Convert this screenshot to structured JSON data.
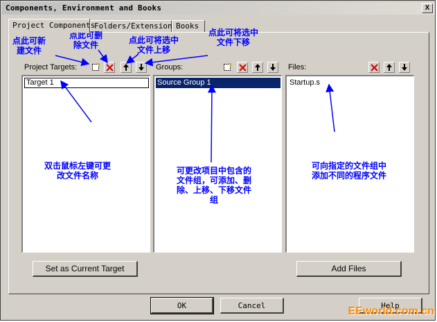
{
  "window": {
    "title": "Components, Environment and Books",
    "close": "X"
  },
  "tabs": [
    {
      "label": "Project Components",
      "active": true
    },
    {
      "label": "Folders/Extensions",
      "active": false
    },
    {
      "label": "Books",
      "active": false
    }
  ],
  "panels": {
    "targets": {
      "label": "Project Targets:",
      "items": [
        "Target 1"
      ]
    },
    "groups": {
      "label": "Groups:",
      "items": [
        "Source Group 1"
      ]
    },
    "files": {
      "label": "Files:",
      "items": [
        "Startup.s"
      ]
    }
  },
  "buttons": {
    "set_current_target": "Set as Current Target",
    "add_files": "Add Files",
    "ok": "OK",
    "cancel": "Cancel",
    "help": "Help"
  },
  "annotations": {
    "new_file": "点此可新\n建文件",
    "delete_file": "点此可删\n除文件",
    "move_up": "点此可将选中\n文件上移",
    "move_down": "点此可将选中\n文件下移",
    "rename": "双击鼠标左键可更\n改文件名称",
    "groups_note": "可更改项目中包含的\n文件组，可添加、删\n除、上移、下移文件\n组",
    "files_note": "可向指定的文件组中\n添加不同的程序文件"
  },
  "watermark": "EEworld.com.cn",
  "colors": {
    "annotation": "#0000ff",
    "selection": "#0a246a",
    "delete_icon": "#d40000",
    "dialog_face": "#d4d0c8"
  },
  "icons": {
    "new": "new-file-icon",
    "delete": "delete-x-icon",
    "up": "arrow-up-icon",
    "down": "arrow-down-icon"
  }
}
